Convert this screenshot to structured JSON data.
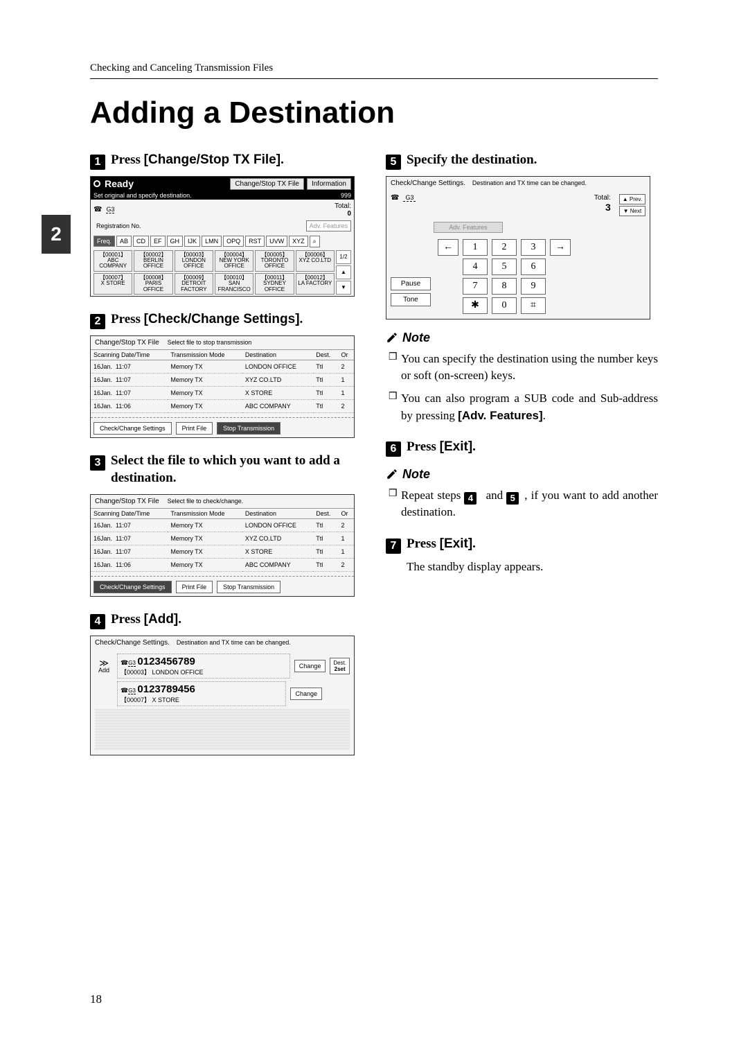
{
  "breadcrumb": "Checking and Canceling Transmission Files",
  "page_title": "Adding a Destination",
  "side_tab": "2",
  "page_number": "18",
  "steps": {
    "s1": {
      "num": "1",
      "pre": "Press ",
      "bold": "[Change/Stop TX File]",
      "post": "."
    },
    "s2": {
      "num": "2",
      "pre": "Press ",
      "bold": "[Check/Change Settings]",
      "post": "."
    },
    "s3": {
      "num": "3",
      "text": "Select the file to which you want to add a destination."
    },
    "s4": {
      "num": "4",
      "pre": "Press ",
      "bold": "[Add]",
      "post": "."
    },
    "s5": {
      "num": "5",
      "text": "Specify the destination."
    },
    "s6": {
      "num": "6",
      "pre": "Press ",
      "bold": "[Exit]",
      "post": "."
    },
    "s7": {
      "num": "7",
      "pre": "Press ",
      "bold": "[Exit]",
      "post": "."
    }
  },
  "notes": {
    "label": "Note",
    "n1": "You can specify the destination using the number keys or soft (on-screen) keys.",
    "n2_a": "You can also program a SUB code and Sub-address by pressing ",
    "n2_b": "[Adv. Features]",
    "n2_c": ".",
    "n3_a": "Repeat steps ",
    "n3_b": " and ",
    "n3_c": ", if you want to add another destination."
  },
  "standby": "The standby display appears.",
  "panel1": {
    "ready": "Ready",
    "btn_change": "Change/Stop TX File",
    "btn_info": "Information",
    "sub": "Set original and specify destination.",
    "count": "999",
    "g3": "G3",
    "total_lbl": "Total:",
    "total_val": "0",
    "reg": "Registration No.",
    "adv": "Adv. Features",
    "tabs": [
      "Freq.",
      "AB",
      "CD",
      "EF",
      "GH",
      "IJK",
      "LMN",
      "OPQ",
      "RST",
      "UVW",
      "XYZ"
    ],
    "search_icon": "⌕",
    "row1": [
      {
        "id": "【00001】",
        "name": "ABC COMPANY"
      },
      {
        "id": "【00002】",
        "name": "BERLIN OFFICE"
      },
      {
        "id": "【00003】",
        "name": "LONDON OFFICE"
      },
      {
        "id": "【00004】",
        "name": "NEW YORK OFFICE"
      },
      {
        "id": "【00005】",
        "name": "TORONTO OFFICE"
      },
      {
        "id": "【00006】",
        "name": "XYZ CO.LTD"
      }
    ],
    "row2": [
      {
        "id": "【00007】",
        "name": "X STORE"
      },
      {
        "id": "【00008】",
        "name": "PARIS OFFICE"
      },
      {
        "id": "【00009】",
        "name": "DETROIT FACTORY"
      },
      {
        "id": "【00010】",
        "name": "SAN FRANCISCO"
      },
      {
        "id": "【00011】",
        "name": "SYDNEY OFFICE"
      },
      {
        "id": "【00012】",
        "name": "LA FACTORY"
      }
    ],
    "pager": "1/2",
    "up": "▲",
    "down": "▼"
  },
  "panel_files": {
    "title": "Change/Stop TX File",
    "sub_stop": "Select file to stop transmission",
    "sub_change": "Select file to check/change.",
    "headers": [
      "Scanning Date/Time",
      "Transmission Mode",
      "Destination",
      "Dest.",
      "Or"
    ],
    "rows": [
      {
        "date": "16Jan.",
        "time": "11:07",
        "mode": "Memory TX",
        "dest": "LONDON OFFICE",
        "d": "Ttl",
        "n": "2"
      },
      {
        "date": "16Jan.",
        "time": "11:07",
        "mode": "Memory TX",
        "dest": "XYZ CO.LTD",
        "d": "Ttl",
        "n": "1"
      },
      {
        "date": "16Jan.",
        "time": "11:07",
        "mode": "Memory TX",
        "dest": "X STORE",
        "d": "Ttl",
        "n": "1"
      },
      {
        "date": "16Jan.",
        "time": "11:06",
        "mode": "Memory TX",
        "dest": "ABC COMPANY",
        "d": "Ttl",
        "n": "2"
      }
    ],
    "btn_settings": "Check/Change Settings",
    "btn_print": "Print File",
    "btn_stop": "Stop Transmission"
  },
  "panel_chk": {
    "title": "Check/Change Settings.",
    "sub": "Destination and TX time can be changed.",
    "add_sym": "≫",
    "add_lbl": "Add",
    "g3": "G3",
    "d1_num": "0123456789",
    "d1_id": "【00003】",
    "d1_name": "LONDON OFFICE",
    "d2_num": "0123789456",
    "d2_id": "【00007】",
    "d2_name": "X STORE",
    "change": "Change",
    "dest_lbl": "Dest.",
    "dest_n": "2set"
  },
  "panel_kp": {
    "title": "Check/Change Settings.",
    "sub": "Destination and TX time can be changed.",
    "g3": "G3",
    "total_lbl": "Total:",
    "total_val": "3",
    "prev": "▲ Prev.",
    "next": "▼ Next",
    "adv": "Adv. Features",
    "left_arrow": "←",
    "right_arrow": "→",
    "keys": [
      "1",
      "2",
      "3",
      "4",
      "5",
      "6",
      "7",
      "8",
      "9",
      "✱",
      "0",
      "⌗"
    ],
    "pause": "Pause",
    "tone": "Tone"
  }
}
